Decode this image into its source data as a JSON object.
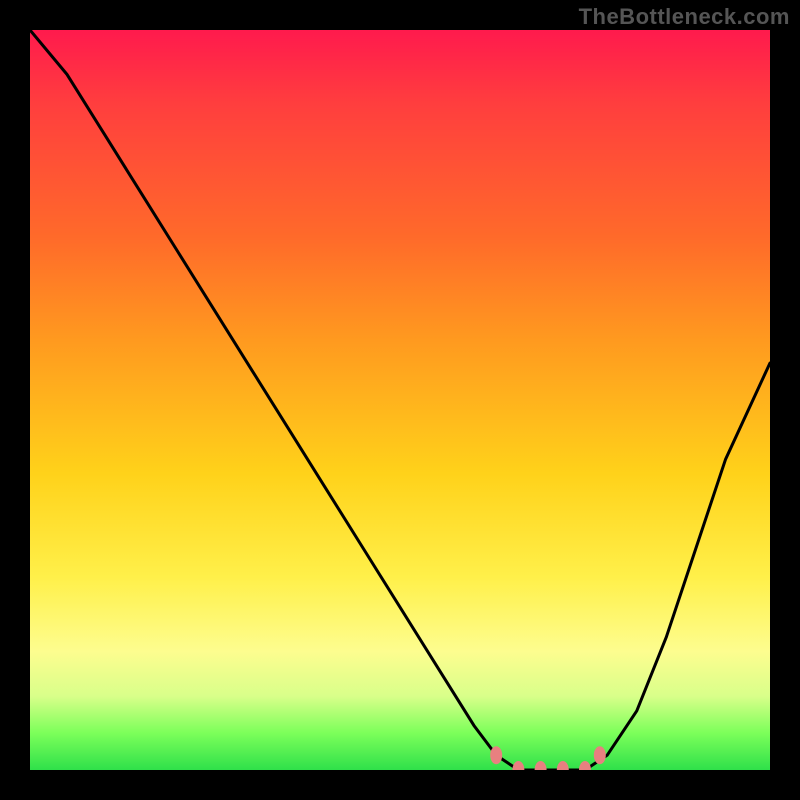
{
  "watermark": "TheBottleneck.com",
  "chart_data": {
    "type": "line",
    "title": "",
    "xlabel": "",
    "ylabel": "",
    "x": [
      0.0,
      0.05,
      0.1,
      0.15,
      0.2,
      0.25,
      0.3,
      0.35,
      0.4,
      0.45,
      0.5,
      0.55,
      0.6,
      0.63,
      0.66,
      0.69,
      0.72,
      0.75,
      0.78,
      0.82,
      0.86,
      0.9,
      0.94,
      1.0
    ],
    "values": [
      1.0,
      0.94,
      0.86,
      0.78,
      0.7,
      0.62,
      0.54,
      0.46,
      0.38,
      0.3,
      0.22,
      0.14,
      0.06,
      0.02,
      0.0,
      0.0,
      0.0,
      0.0,
      0.02,
      0.08,
      0.18,
      0.3,
      0.42,
      0.55
    ],
    "xlim": [
      0,
      1
    ],
    "ylim": [
      0,
      1
    ],
    "markers": {
      "x": [
        0.63,
        0.66,
        0.69,
        0.72,
        0.75,
        0.77
      ],
      "y": [
        0.02,
        0.0,
        0.0,
        0.0,
        0.0,
        0.02
      ],
      "color": "#e88080"
    },
    "annotations": [],
    "legend": null
  },
  "colors": {
    "gradient_top": "#ff1a4d",
    "gradient_mid": "#ffd21a",
    "gradient_bottom": "#2fe04a",
    "curve": "#000000",
    "marker": "#e88080",
    "background_frame": "#000000"
  }
}
